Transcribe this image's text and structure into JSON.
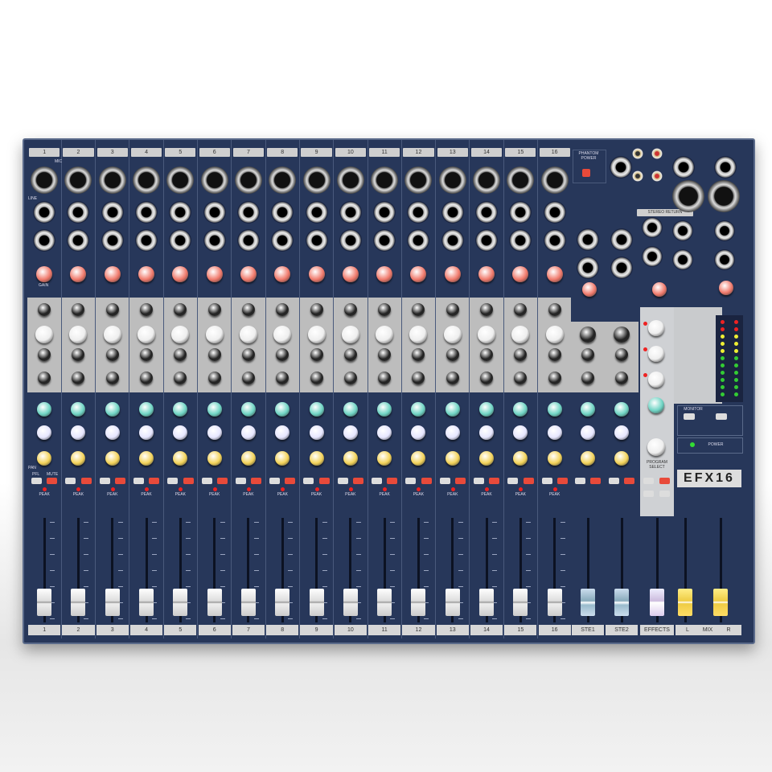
{
  "product": {
    "model": "EFX16",
    "brand_color": "#27375a"
  },
  "channels": [
    "1",
    "2",
    "3",
    "4",
    "5",
    "6",
    "7",
    "8",
    "9",
    "10",
    "11",
    "12",
    "13",
    "14",
    "15",
    "16"
  ],
  "stereo_channels": [
    "STE1",
    "STE2"
  ],
  "effects_label": "EFFECTS",
  "master": {
    "left": "L",
    "mix": "MIX",
    "right": "R"
  },
  "labels": {
    "peak": "PEAK",
    "power": "POWER",
    "stereo_return": "STEREO RETURN",
    "phantom_power": "PHANTOM POWER",
    "monitor": "MONITOR",
    "mic": "MIC",
    "line": "LINE",
    "gain": "GAIN",
    "pan": "PAN",
    "mute": "MUTE",
    "pfl": "PFL",
    "program_select": "PROGRAM SELECT"
  }
}
